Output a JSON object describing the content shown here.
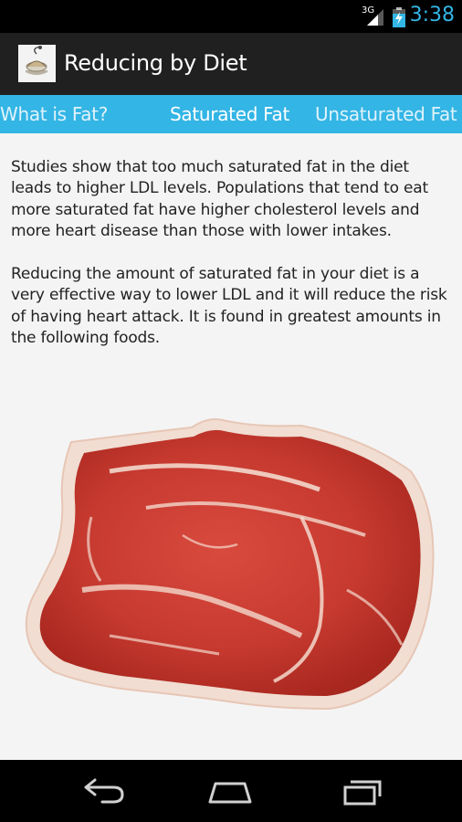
{
  "status_bar": {
    "network_type": "3G",
    "time": "3:38",
    "icons": [
      "signal-icon",
      "battery-icon"
    ]
  },
  "action_bar": {
    "title": "Reducing by Diet",
    "app_icon": "gravy-boat-icon"
  },
  "tabs": [
    {
      "label": "What is Fat?",
      "active": false
    },
    {
      "label": "Saturated Fat",
      "active": true
    },
    {
      "label": "Unsaturated Fat",
      "active": false
    }
  ],
  "content": {
    "paragraph_1": "Studies show that too much saturated fat in the diet leads to higher LDL levels. Populations that tend to eat more saturated fat have higher cholesterol levels and more heart disease than those with lower intakes.",
    "paragraph_2": "Reducing the amount of saturated fat in your diet is a very effective way to lower LDL and it will reduce the risk of having heart attack. It is found in greatest amounts in the following foods.",
    "image": "raw-steak-image"
  },
  "nav_bar": {
    "icons": [
      "back-icon",
      "home-icon",
      "recent-apps-icon"
    ]
  },
  "colors": {
    "accent": "#33b5e5",
    "action_bar": "#202020",
    "content_bg": "#f4f4f4",
    "text": "#222222"
  }
}
